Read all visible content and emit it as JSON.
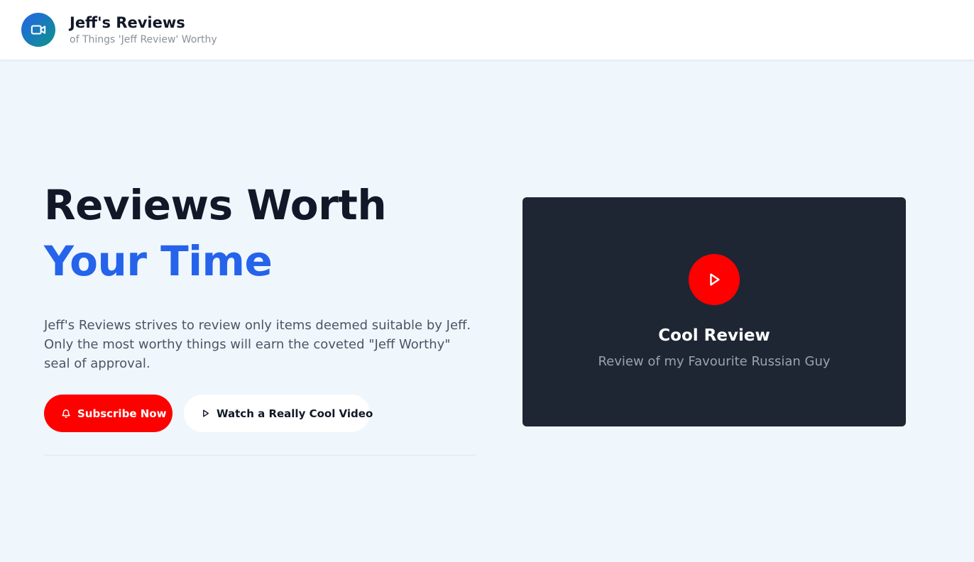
{
  "header": {
    "title": "Jeff's Reviews",
    "tagline": "of Things 'Jeff Review' Worthy",
    "logo_icon": "video-camera-icon"
  },
  "hero": {
    "headline_line1": "Reviews Worth",
    "headline_line2": "Your Time",
    "description": "Jeff's Reviews strives to review only items deemed suitable by Jeff. Only the most worthy things will earn the coveted \"Jeff Worthy\" seal of approval.",
    "subscribe_label": "Subscribe Now",
    "subscribe_icon": "bell-icon",
    "watch_label": "Watch a Really Cool Video",
    "watch_icon": "play-icon"
  },
  "video_card": {
    "title": "Cool Review",
    "subtitle": "Review of my Favourite Russian Guy",
    "play_icon": "play-icon"
  },
  "colors": {
    "accent_blue": "#2563eb",
    "youtube_red": "#ff0000",
    "card_dark": "#1e2634",
    "page_bg": "#eff7fd"
  }
}
